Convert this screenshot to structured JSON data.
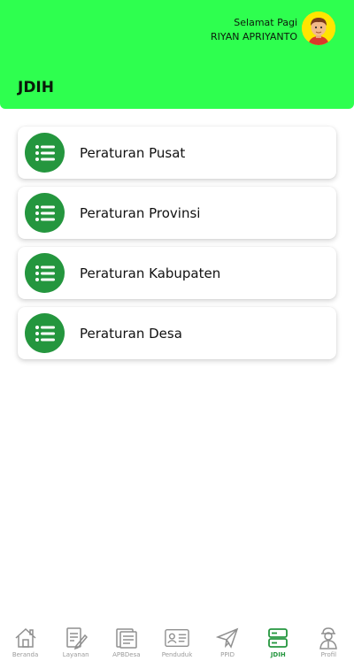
{
  "header": {
    "greeting": "Selamat Pagi",
    "user_name": "RIYAN APRIYANTO",
    "page_title": "JDIH"
  },
  "menu": [
    {
      "label": "Peraturan Pusat",
      "icon": "list-icon"
    },
    {
      "label": "Peraturan Provinsi",
      "icon": "list-icon"
    },
    {
      "label": "Peraturan Kabupaten",
      "icon": "list-icon"
    },
    {
      "label": "Peraturan Desa",
      "icon": "list-icon"
    }
  ],
  "bottom_nav": [
    {
      "label": "Beranda",
      "icon": "home-icon"
    },
    {
      "label": "Layanan",
      "icon": "form-icon"
    },
    {
      "label": "APBDesa",
      "icon": "budget-icon"
    },
    {
      "label": "Penduduk",
      "icon": "id-card-icon"
    },
    {
      "label": "PPID",
      "icon": "paper-plane-icon"
    },
    {
      "label": "JDIH",
      "icon": "server-icon",
      "active": true
    },
    {
      "label": "Profil",
      "icon": "person-icon"
    }
  ],
  "colors": {
    "header_bg": "#2eff4f",
    "accent": "#24963e",
    "inactive": "#9a9a9a"
  }
}
